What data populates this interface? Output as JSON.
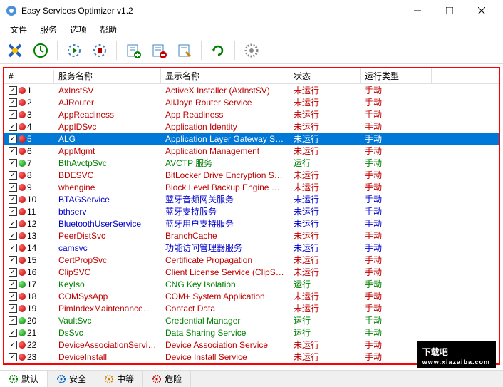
{
  "window": {
    "title": "Easy Services Optimizer v1.2"
  },
  "menu": [
    "文件",
    "服务",
    "选项",
    "帮助"
  ],
  "columns": {
    "num": "#",
    "name": "服务名称",
    "display": "显示名称",
    "state": "状态",
    "start": "运行类型"
  },
  "state": {
    "stopped": "未运行",
    "running": "运行"
  },
  "start": {
    "manual": "手动"
  },
  "rows": [
    {
      "n": "1",
      "svc": "AxInstSV",
      "disp": "ActiveX Installer (AxInstSV)",
      "st": "stopped",
      "dot": "r",
      "cls": "red"
    },
    {
      "n": "2",
      "svc": "AJRouter",
      "disp": "AllJoyn Router Service",
      "st": "stopped",
      "dot": "r",
      "cls": "red"
    },
    {
      "n": "3",
      "svc": "AppReadiness",
      "disp": "App Readiness",
      "st": "stopped",
      "dot": "r",
      "cls": "red"
    },
    {
      "n": "4",
      "svc": "AppIDSvc",
      "disp": "Application Identity",
      "st": "stopped",
      "dot": "r",
      "cls": "red"
    },
    {
      "n": "5",
      "svc": "ALG",
      "disp": "Application Layer Gateway Ser...",
      "st": "stopped",
      "dot": "r",
      "cls": "red",
      "sel": true
    },
    {
      "n": "6",
      "svc": "AppMgmt",
      "disp": "Application Management",
      "st": "stopped",
      "dot": "r",
      "cls": "red"
    },
    {
      "n": "7",
      "svc": "BthAvctpSvc",
      "disp": "AVCTP 服务",
      "st": "running",
      "dot": "g",
      "cls": "green"
    },
    {
      "n": "8",
      "svc": "BDESVC",
      "disp": "BitLocker Drive Encryption Service",
      "st": "stopped",
      "dot": "r",
      "cls": "red"
    },
    {
      "n": "9",
      "svc": "wbengine",
      "disp": "Block Level Backup Engine Service",
      "st": "stopped",
      "dot": "r",
      "cls": "red"
    },
    {
      "n": "10",
      "svc": "BTAGService",
      "disp": "蓝牙音频网关服务",
      "st": "stopped",
      "dot": "r",
      "cls": "blue"
    },
    {
      "n": "11",
      "svc": "bthserv",
      "disp": "蓝牙支持服务",
      "st": "stopped",
      "dot": "r",
      "cls": "blue"
    },
    {
      "n": "12",
      "svc": "BluetoothUserService",
      "disp": "蓝牙用户支持服务",
      "st": "stopped",
      "dot": "r",
      "cls": "blue"
    },
    {
      "n": "13",
      "svc": "PeerDistSvc",
      "disp": "BranchCache",
      "st": "stopped",
      "dot": "r",
      "cls": "red"
    },
    {
      "n": "14",
      "svc": "camsvc",
      "disp": "功能访问管理器服务",
      "st": "stopped",
      "dot": "r",
      "cls": "blue"
    },
    {
      "n": "15",
      "svc": "CertPropSvc",
      "disp": "Certificate Propagation",
      "st": "stopped",
      "dot": "r",
      "cls": "red"
    },
    {
      "n": "16",
      "svc": "ClipSVC",
      "disp": "Client License Service (ClipSVC)",
      "st": "stopped",
      "dot": "r",
      "cls": "red"
    },
    {
      "n": "17",
      "svc": "KeyIso",
      "disp": "CNG Key Isolation",
      "st": "running",
      "dot": "g",
      "cls": "green"
    },
    {
      "n": "18",
      "svc": "COMSysApp",
      "disp": "COM+ System Application",
      "st": "stopped",
      "dot": "r",
      "cls": "red"
    },
    {
      "n": "19",
      "svc": "PimIndexMaintenanceSvc",
      "disp": "Contact Data",
      "st": "stopped",
      "dot": "r",
      "cls": "red"
    },
    {
      "n": "20",
      "svc": "VaultSvc",
      "disp": "Credential Manager",
      "st": "running",
      "dot": "g",
      "cls": "green"
    },
    {
      "n": "21",
      "svc": "DsSvc",
      "disp": "Data Sharing Service",
      "st": "running",
      "dot": "g",
      "cls": "green"
    },
    {
      "n": "22",
      "svc": "DeviceAssociationService",
      "disp": "Device Association Service",
      "st": "stopped",
      "dot": "r",
      "cls": "red"
    },
    {
      "n": "23",
      "svc": "DeviceInstall",
      "disp": "Device Install Service",
      "st": "stopped",
      "dot": "r",
      "cls": "red"
    }
  ],
  "tabs": [
    {
      "l": "默认",
      "c": "#008000"
    },
    {
      "l": "安全",
      "c": "#0060c0"
    },
    {
      "l": "中等",
      "c": "#d08000"
    },
    {
      "l": "危险",
      "c": "#c00000"
    }
  ],
  "watermark": {
    "main": "下载吧",
    "sub": "www.xiazaiba.com"
  }
}
